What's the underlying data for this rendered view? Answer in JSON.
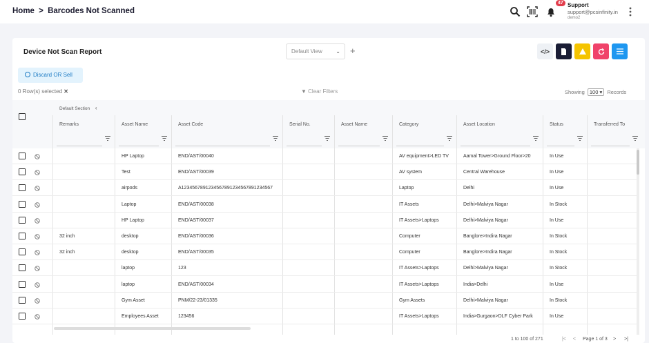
{
  "breadcrumb": {
    "home": "Home",
    "sep": ">",
    "current": "Barcodes Not Scanned"
  },
  "topbar": {
    "notification_count": "47",
    "user_name": "Support",
    "user_email": "support@pcsinfinity.in",
    "user_org": "demo2"
  },
  "card": {
    "title": "Device Not Scan Report",
    "view_select": "Default View",
    "add": "+"
  },
  "toolbar": {
    "colors": {
      "code": "#eef1f5",
      "pdf": "#1a1d35",
      "warn": "#f5c400",
      "refresh": "#f0436a",
      "columns": "#1e97f0"
    }
  },
  "actions": {
    "discard": "Discard OR Sell",
    "rows_selected": "0 Row(s) selected",
    "clear_filters": "Clear Filters",
    "showing": "Showing",
    "page_size": "100",
    "records": "Records"
  },
  "table": {
    "section": "Default Section",
    "columns": [
      "Remarks",
      "Asset Name",
      "Asset Code",
      "Serial No.",
      "Asset Name",
      "Category",
      "Asset Location",
      "Status",
      "Transferred To"
    ],
    "rows": [
      [
        "",
        "HP Laptop",
        "END/AST/00040",
        "",
        "",
        "AV equipment>LED TV",
        "Aamal Tower>Ground Floor>20",
        "In Use",
        ""
      ],
      [
        "",
        "Test",
        "END/AST/00039",
        "",
        "",
        "AV system",
        "Central Warehouse",
        "In Use",
        ""
      ],
      [
        "",
        "airpods",
        "A12345678912345678912345678912345​67",
        "",
        "",
        "Laptop",
        "Delhi",
        "In Use",
        ""
      ],
      [
        "",
        "Laptop",
        "END/AST/00038",
        "",
        "",
        "IT Assets",
        "Delhi>Malviya Nagar",
        "In Stock",
        ""
      ],
      [
        "",
        "HP Laptop",
        "END/AST/00037",
        "",
        "",
        "IT Assets>Laptops",
        "Delhi>Malviya Nagar",
        "In Use",
        ""
      ],
      [
        "32 inch",
        "desktop",
        "END/AST/00036",
        "",
        "",
        "Computer",
        "Banglore>Indira Nagar",
        "In Stock",
        ""
      ],
      [
        "32 inch",
        "desktop",
        "END/AST/00035",
        "",
        "",
        "Computer",
        "Banglore>Indira Nagar",
        "In Stock",
        ""
      ],
      [
        "",
        "laptop",
        "123",
        "",
        "",
        "IT Assets>Laptops",
        "Delhi>Malviya Nagar",
        "In Stock",
        ""
      ],
      [
        "",
        "laptop",
        "END/AST/00034",
        "",
        "",
        "IT Assets>Laptops",
        "India>Delhi",
        "In Use",
        ""
      ],
      [
        "",
        "Gym Asset",
        "PNM/22-23/01335",
        "",
        "",
        "Gym Assets",
        "Delhi>Malviya Nagar",
        "In Stock",
        ""
      ],
      [
        "",
        "Employees Asset",
        "123456",
        "",
        "",
        "IT Assets>Laptops",
        "India>Gurgaon>DLF Cyber Park",
        "In Use",
        ""
      ]
    ]
  },
  "pager": {
    "range": "1 to 100 of 271",
    "page": "Page 1 of 3"
  }
}
